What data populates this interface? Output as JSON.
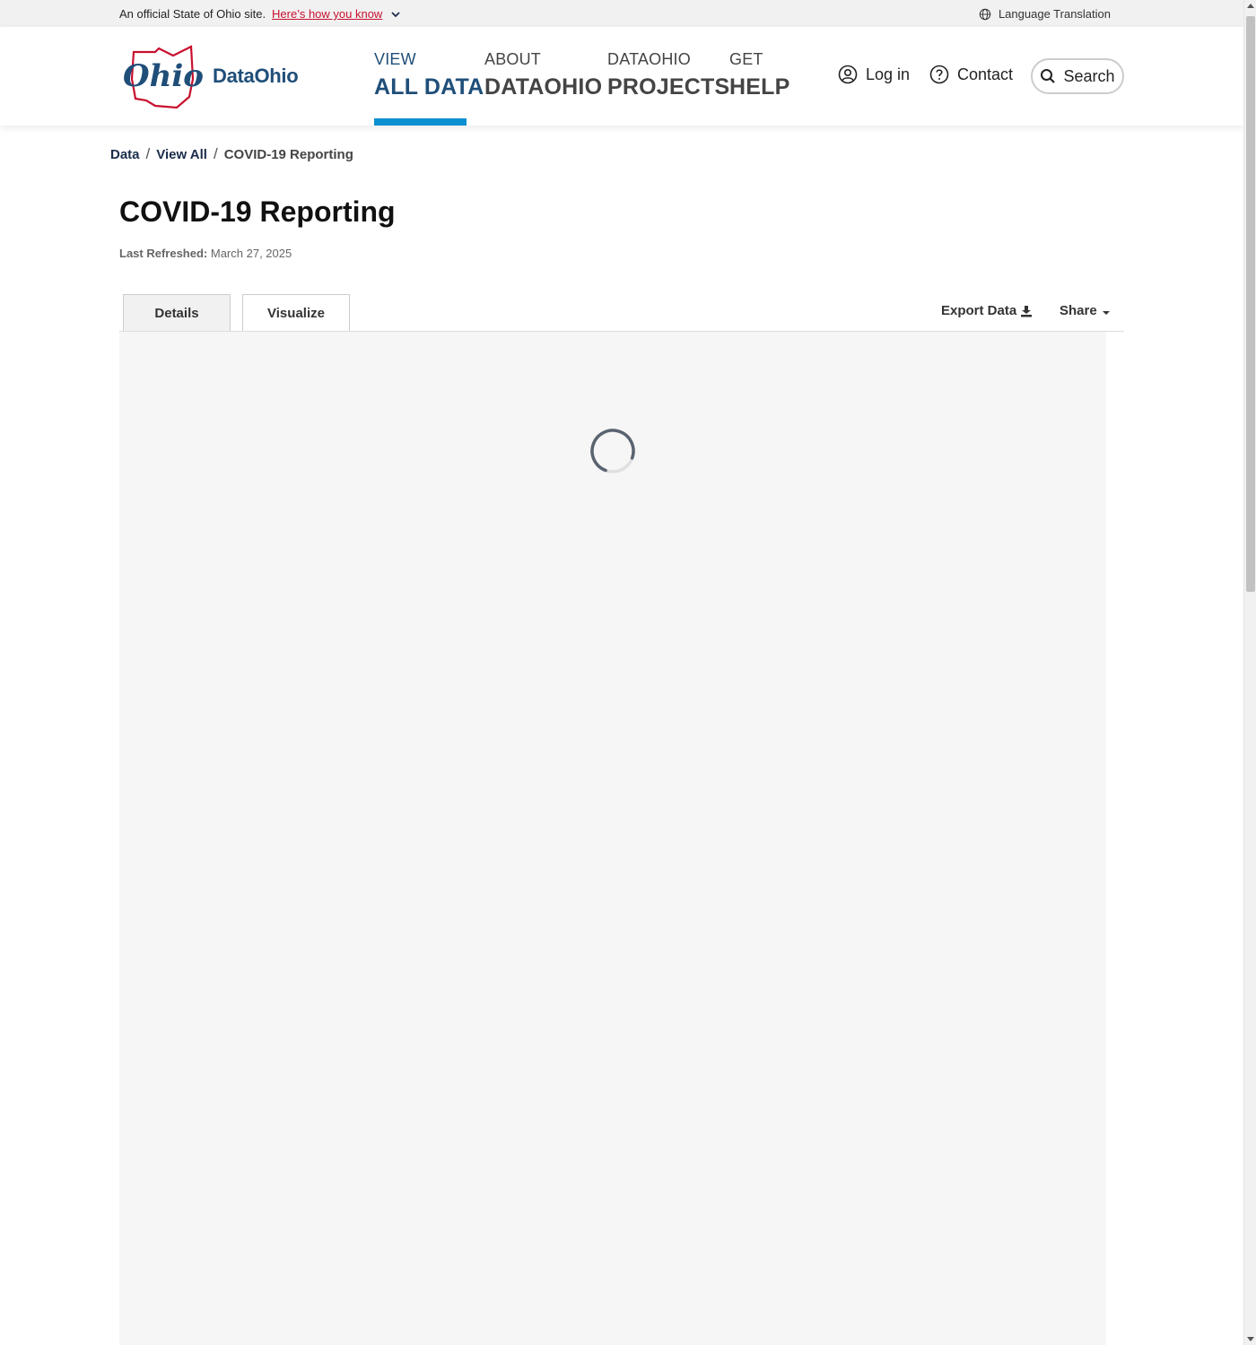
{
  "gov_banner": {
    "text": "An official State of Ohio site.",
    "link": "Here’s how you know",
    "language": "Language Translation"
  },
  "header": {
    "logo_script": "Ohio",
    "logo_text": "DataOhio",
    "nav": [
      {
        "small": "VIEW",
        "big": "ALL DATA",
        "active": true
      },
      {
        "small": "ABOUT",
        "big": "DATAOHIO",
        "active": false
      },
      {
        "small": "DATAOHIO",
        "big": "PROJECTS",
        "active": false
      },
      {
        "small": "GET",
        "big": "HELP",
        "active": false
      }
    ],
    "login": "Log in",
    "contact": "Contact",
    "search": "Search"
  },
  "breadcrumb": {
    "items": [
      "Data",
      "View All"
    ],
    "current": "COVID-19 Reporting"
  },
  "page": {
    "title": "COVID-19 Reporting",
    "refreshed_label": "Last Refreshed:",
    "refreshed_value": "March 27, 2025"
  },
  "tabs": [
    {
      "label": "Details",
      "active": false
    },
    {
      "label": "Visualize",
      "active": true
    }
  ],
  "actions": {
    "export": "Export Data",
    "share": "Share"
  },
  "colors": {
    "brand_blue": "#1f4e79",
    "accent_blue": "#0a8fd1",
    "brand_red": "#c8102e"
  }
}
